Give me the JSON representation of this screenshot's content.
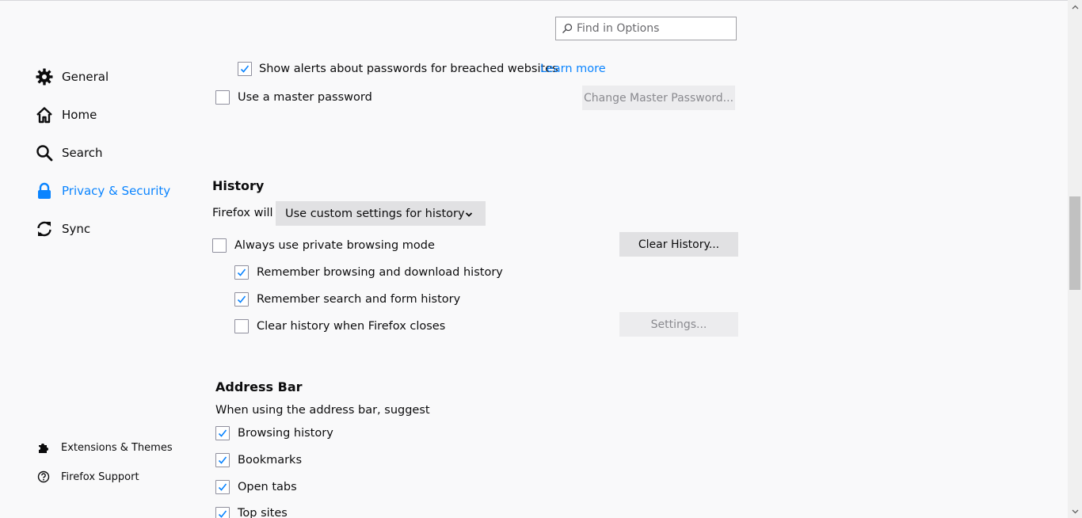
{
  "search": {
    "placeholder": "Find in Options"
  },
  "sidebar": {
    "items": [
      {
        "label": "General",
        "icon": "gear-icon"
      },
      {
        "label": "Home",
        "icon": "home-icon"
      },
      {
        "label": "Search",
        "icon": "search-icon"
      },
      {
        "label": "Privacy & Security",
        "icon": "lock-icon",
        "selected": true
      },
      {
        "label": "Sync",
        "icon": "sync-icon"
      }
    ],
    "footer": [
      {
        "label": "Extensions & Themes",
        "icon": "puzzle-icon"
      },
      {
        "label": "Firefox Support",
        "icon": "help-icon"
      }
    ]
  },
  "logins": {
    "breached_alerts_label": "Show alerts about passwords for breached websites",
    "breached_alerts_checked": true,
    "learn_more": "Learn more",
    "master_password_label": "Use a master password",
    "master_password_checked": false,
    "change_master_button": "Change Master Password..."
  },
  "history": {
    "title": "History",
    "firefox_will_label": "Firefox will",
    "mode_selected": "Use custom settings for history",
    "private_mode_label": "Always use private browsing mode",
    "private_mode_checked": false,
    "clear_history_button": "Clear History...",
    "remember_browsing_label": "Remember browsing and download history",
    "remember_browsing_checked": true,
    "remember_search_label": "Remember search and form history",
    "remember_search_checked": true,
    "clear_on_close_label": "Clear history when Firefox closes",
    "clear_on_close_checked": false,
    "settings_button": "Settings..."
  },
  "address_bar": {
    "title": "Address Bar",
    "description": "When using the address bar, suggest",
    "options": [
      {
        "label": "Browsing history",
        "checked": true
      },
      {
        "label": "Bookmarks",
        "checked": true
      },
      {
        "label": "Open tabs",
        "checked": true
      },
      {
        "label": "Top sites",
        "checked": true
      }
    ]
  },
  "colors": {
    "accent": "#0a84ff",
    "check": "#0a84ff",
    "background": "#f9f9fa"
  }
}
